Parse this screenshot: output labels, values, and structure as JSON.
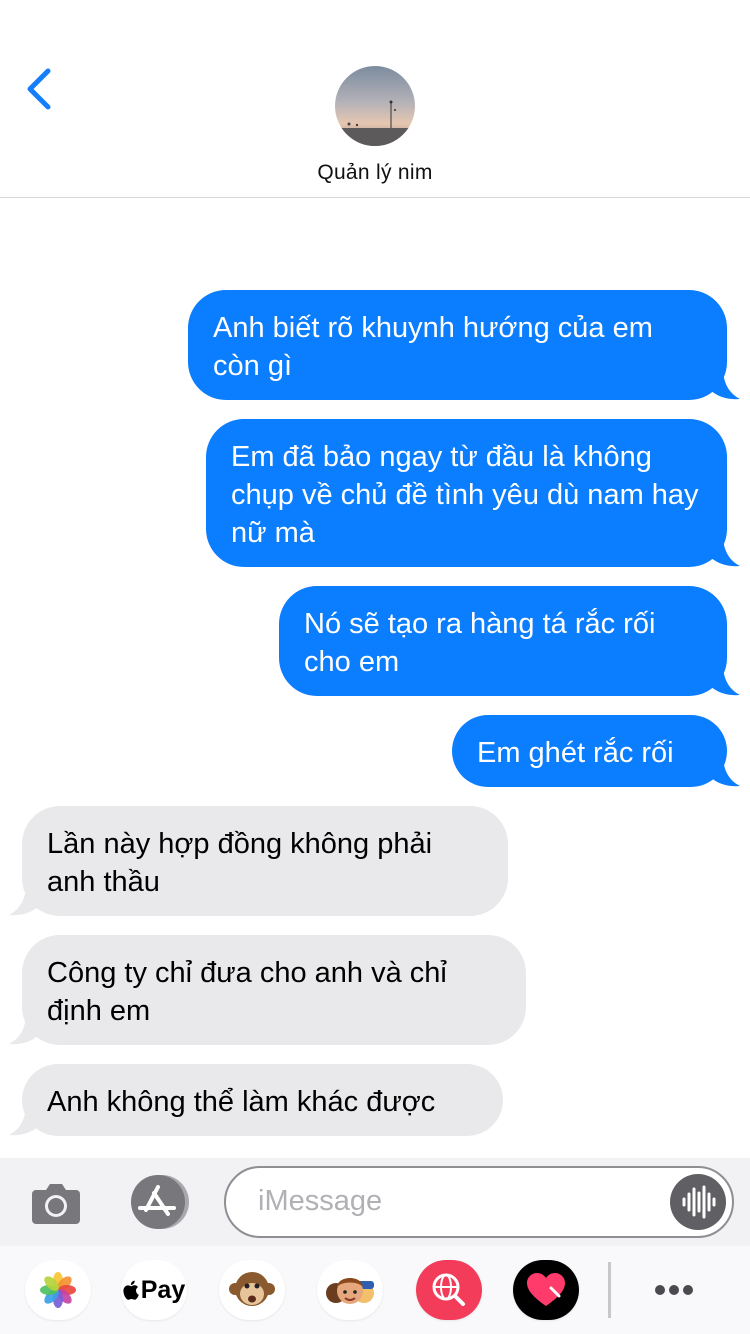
{
  "status": {
    "battery_color": "#f7c400"
  },
  "header": {
    "back_icon": "chevron-left-icon",
    "contact_name": "Quản lý nim"
  },
  "messages": [
    {
      "direction": "sent",
      "text": "Anh biết rõ khuynh hướng của em còn gì"
    },
    {
      "direction": "sent",
      "text": "Em đã bảo ngay từ đầu là không chụp về chủ đề tình yêu dù nam hay nữ mà"
    },
    {
      "direction": "sent",
      "text": "Nó sẽ tạo ra hàng tá rắc rối cho em"
    },
    {
      "direction": "sent",
      "text": "Em ghét rắc rối"
    },
    {
      "direction": "received",
      "text": "Lần này hợp đồng không phải anh thầu"
    },
    {
      "direction": "received",
      "text": "Công ty chỉ đưa cho anh và chỉ định em"
    },
    {
      "direction": "received",
      "text": "Anh không thể làm khác được"
    }
  ],
  "composer": {
    "camera_icon": "camera-icon",
    "apps_icon": "app-store-icon",
    "placeholder": "iMessage",
    "audio_icon": "waveform-icon"
  },
  "app_drawer": {
    "items": [
      {
        "name": "photos",
        "icon": "photos-icon"
      },
      {
        "name": "apple-pay",
        "icon": "apple-pay-icon",
        "label": "Pay"
      },
      {
        "name": "animoji",
        "icon": "monkey-icon"
      },
      {
        "name": "memoji-stickers",
        "icon": "memoji-icon"
      },
      {
        "name": "images-search",
        "icon": "globe-search-icon"
      },
      {
        "name": "digital-touch",
        "icon": "heart-icon"
      }
    ],
    "more_icon": "more-dots-icon"
  },
  "colors": {
    "sent_bubble": "#0b7dff",
    "received_bubble": "#e9e9eb",
    "accent": "#147efb"
  }
}
